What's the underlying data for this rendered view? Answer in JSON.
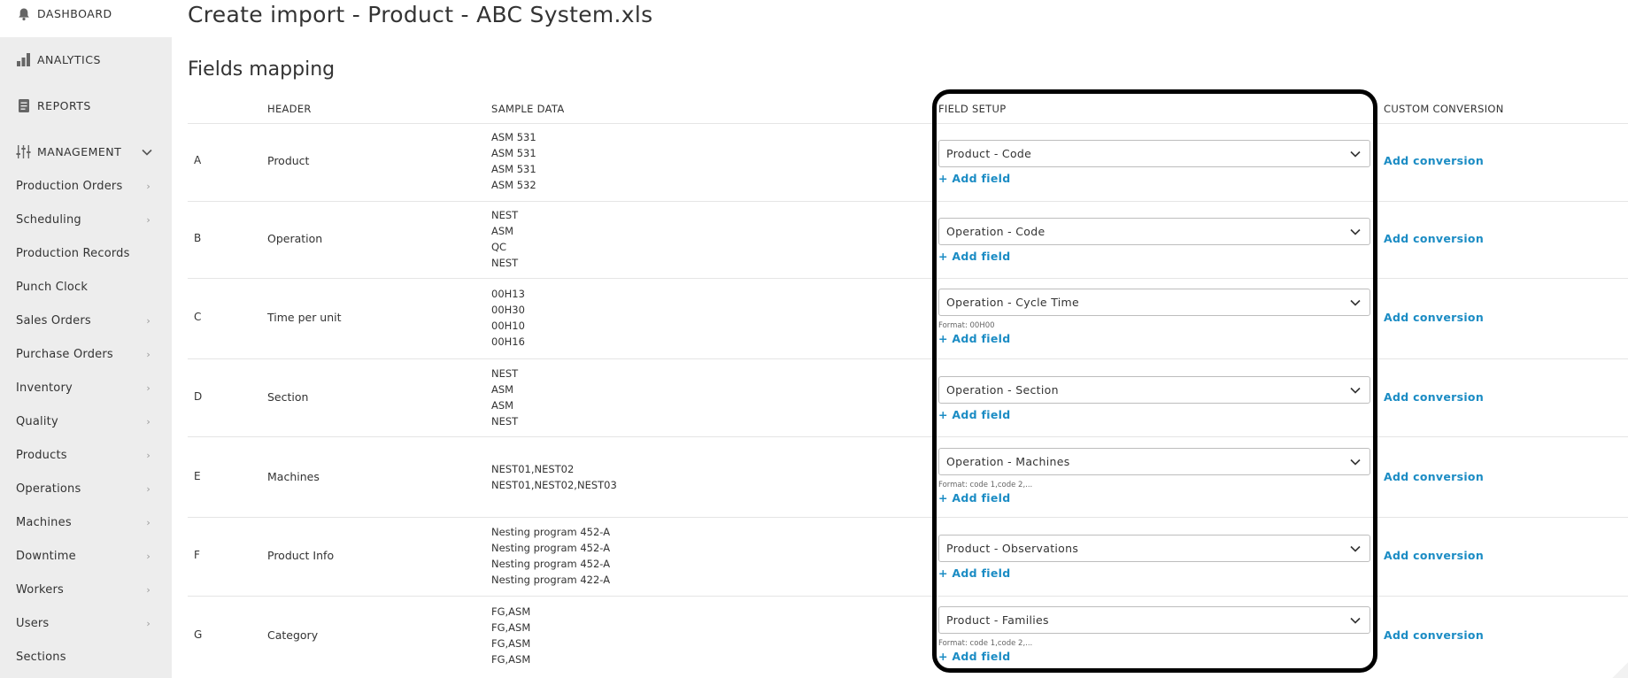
{
  "sidebar": {
    "dashboard": "DASHBOARD",
    "analytics": "ANALYTICS",
    "reports": "REPORTS",
    "management": "MANAGEMENT",
    "items": [
      {
        "label": "Production Orders",
        "chev": "›"
      },
      {
        "label": "Scheduling",
        "chev": "›"
      },
      {
        "label": "Production Records",
        "chev": ""
      },
      {
        "label": "Punch Clock",
        "chev": ""
      },
      {
        "label": "Sales Orders",
        "chev": "›"
      },
      {
        "label": "Purchase Orders",
        "chev": "›"
      },
      {
        "label": "Inventory",
        "chev": "›"
      },
      {
        "label": "Quality",
        "chev": "›"
      },
      {
        "label": "Products",
        "chev": "›"
      },
      {
        "label": "Operations",
        "chev": "›"
      },
      {
        "label": "Machines",
        "chev": "›"
      },
      {
        "label": "Downtime",
        "chev": "›"
      },
      {
        "label": "Workers",
        "chev": "›"
      },
      {
        "label": "Users",
        "chev": "›"
      },
      {
        "label": "Sections",
        "chev": ""
      }
    ]
  },
  "page": {
    "title": "Create import - Product - ABC System.xls",
    "section_title": "Fields mapping"
  },
  "columns": {
    "header": "HEADER",
    "sample": "SAMPLE DATA",
    "field_setup": "FIELD SETUP",
    "custom_conversion": "CUSTOM CONVERSION"
  },
  "rows": [
    {
      "letter": "A",
      "header": "Product",
      "samples": [
        "ASM 531",
        "ASM 531",
        "ASM 531",
        "ASM 532"
      ],
      "field": "Product - Code",
      "format": "",
      "add_field": "+ Add field",
      "add_conversion": "Add conversion"
    },
    {
      "letter": "B",
      "header": "Operation",
      "samples": [
        "NEST",
        "ASM",
        "QC",
        "NEST"
      ],
      "field": "Operation - Code",
      "format": "",
      "add_field": "+ Add field",
      "add_conversion": "Add conversion"
    },
    {
      "letter": "C",
      "header": "Time per unit",
      "samples": [
        "00H13",
        "00H30",
        "00H10",
        "00H16"
      ],
      "field": "Operation - Cycle Time",
      "format": "Format: 00H00",
      "add_field": "+ Add field",
      "add_conversion": "Add conversion"
    },
    {
      "letter": "D",
      "header": "Section",
      "samples": [
        "NEST",
        "ASM",
        "ASM",
        "NEST"
      ],
      "field": "Operation - Section",
      "format": "",
      "add_field": "+ Add field",
      "add_conversion": "Add conversion"
    },
    {
      "letter": "E",
      "header": "Machines",
      "samples": [
        "NEST01,NEST02",
        "NEST01,NEST02,NEST03"
      ],
      "field": "Operation - Machines",
      "format": "Format: code 1,code 2,...",
      "add_field": "+ Add field",
      "add_conversion": "Add conversion"
    },
    {
      "letter": "F",
      "header": "Product Info",
      "samples": [
        "Nesting program 452-A",
        "Nesting program 452-A",
        "Nesting program 452-A",
        "Nesting program 422-A"
      ],
      "field": "Product - Observations",
      "format": "",
      "add_field": "+ Add field",
      "add_conversion": "Add conversion"
    },
    {
      "letter": "G",
      "header": "Category",
      "samples": [
        "FG,ASM",
        "FG,ASM",
        "FG,ASM",
        "FG,ASM"
      ],
      "field": "Product - Families",
      "format": "Format: code 1,code 2,...",
      "add_field": "+ Add field",
      "add_conversion": "Add conversion"
    }
  ],
  "colors": {
    "link": "#1b8cc4",
    "sidebar_bg": "#ededed",
    "highlight": "#000000"
  },
  "icons": {
    "dashboard": "bell-icon",
    "analytics": "bar-chart-icon",
    "reports": "document-icon",
    "management": "sliders-icon"
  }
}
